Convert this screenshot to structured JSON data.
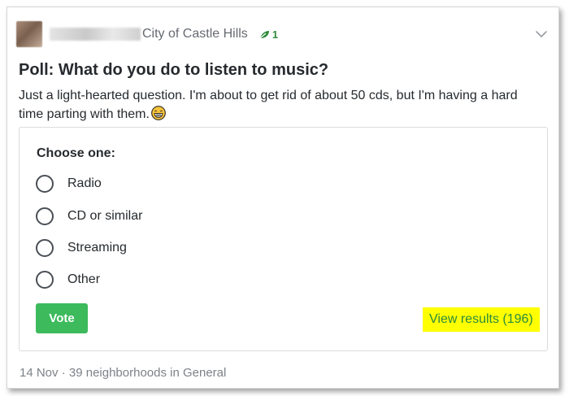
{
  "post": {
    "neighborhood": "City of Castle Hills",
    "badge_count": "1",
    "title": "Poll: What do you do to listen to music?",
    "body": "Just a light-hearted question. I'm about to get rid of about 50 cds, but I'm having a hard time parting with them."
  },
  "poll": {
    "prompt": "Choose one:",
    "options": [
      "Radio",
      "CD or similar",
      "Streaming",
      "Other"
    ],
    "vote_label": "Vote",
    "results_label": "View results (196)"
  },
  "footer": {
    "date": "14 Nov",
    "separator": "·",
    "audience": "39 neighborhoods in General"
  },
  "colors": {
    "accent_green": "#3cba5c",
    "link_green": "#2a8a3f",
    "highlight": "#ffff00"
  }
}
